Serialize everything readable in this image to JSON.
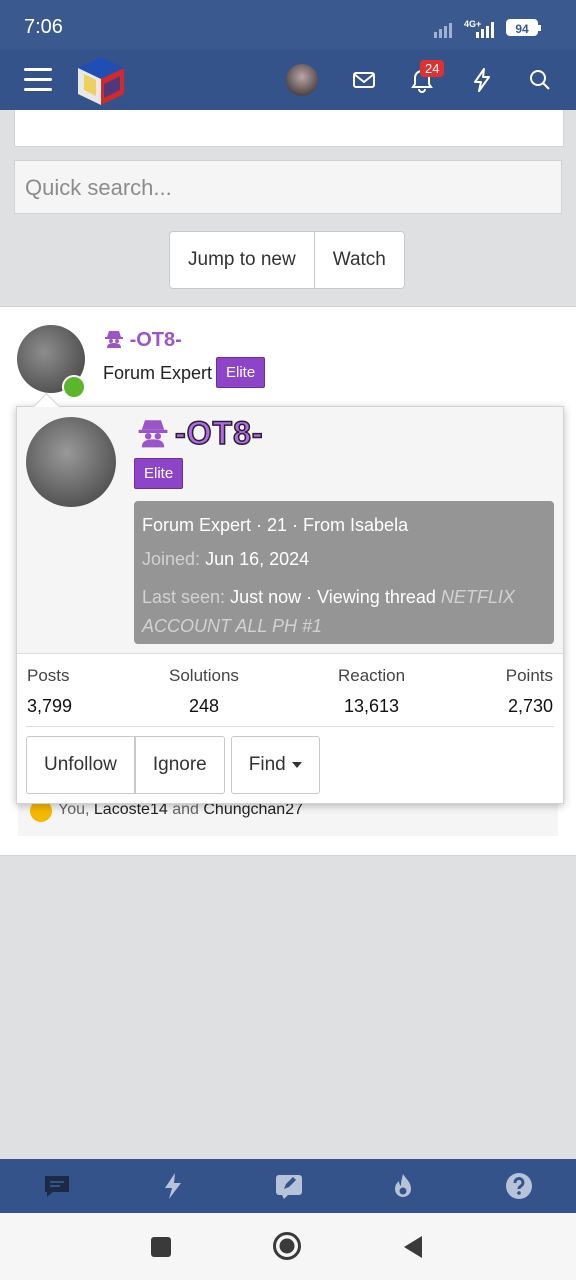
{
  "status_bar": {
    "time": "7:06",
    "network": "4G+",
    "battery": "94"
  },
  "app_bar": {
    "notification_count": "24"
  },
  "search": {
    "placeholder": "Quick search..."
  },
  "buttons": {
    "jump_to_new": "Jump to new",
    "watch": "Watch"
  },
  "post": {
    "username": "-OT8-",
    "user_title": "Forum Expert",
    "banner": "Elite"
  },
  "profile_card": {
    "username": "-OT8-",
    "banner": "Elite",
    "info_line": "Forum Expert · 21 · From Isabela",
    "joined_label": "Joined:",
    "joined_value": "Jun 16, 2024",
    "last_seen_label": "Last seen:",
    "last_seen_value": "Just now · Viewing thread",
    "last_seen_thread": "NETFLIX ACCOUNT ALL PH #1",
    "stats": [
      {
        "label": "Posts",
        "value": "3,799"
      },
      {
        "label": "Solutions",
        "value": "248"
      },
      {
        "label": "Reaction",
        "value": "13,613"
      },
      {
        "label": "Points",
        "value": "2,730"
      }
    ],
    "actions": {
      "unfollow": "Unfollow",
      "ignore": "Ignore",
      "find": "Find"
    }
  },
  "reactions": {
    "prefix": "You,",
    "user1": "Lacoste14",
    "conj": "and",
    "user2": "Chungchan27"
  },
  "colors": {
    "header": "#34538a",
    "status_bar": "#3a5a8f",
    "username": "#9b55c9",
    "banner": "#8e44c8",
    "online": "#5bb62c"
  },
  "icons": [
    "menu-icon",
    "site-logo",
    "avatar",
    "mail-icon",
    "bell-icon",
    "bolt-icon",
    "search-icon",
    "chat-icon",
    "whats-new-icon",
    "compose-icon",
    "trending-icon",
    "help-icon"
  ]
}
